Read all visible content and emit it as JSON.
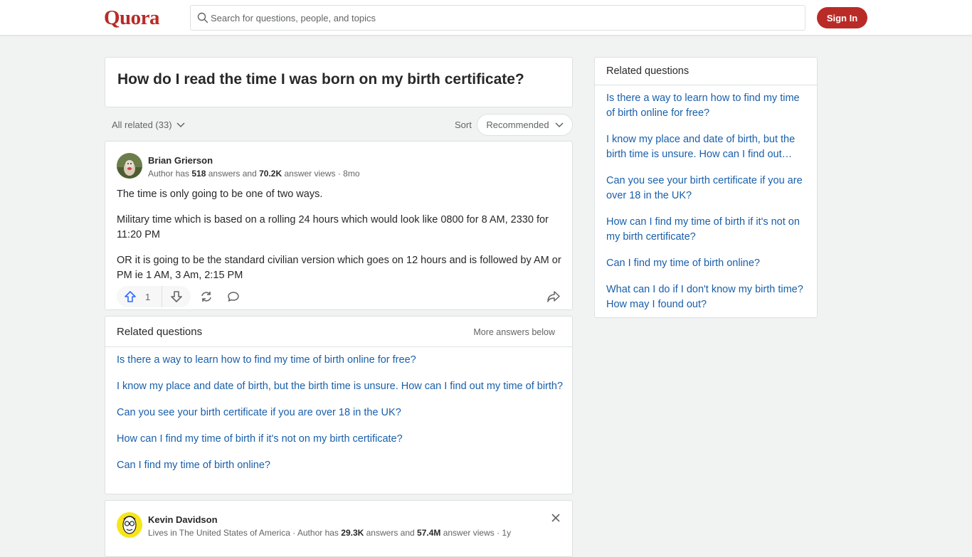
{
  "header": {
    "logo": "Quora",
    "search_placeholder": "Search for questions, people, and topics",
    "signin_label": "Sign In"
  },
  "question": {
    "title": "How do I read the time I was born on my birth certificate?"
  },
  "filters": {
    "all_related": "All related (33)",
    "sort_label": "Sort",
    "sort_value": "Recommended"
  },
  "answers": [
    {
      "author": "Brian Grierson",
      "meta_prefix": "Author has ",
      "answers_count": "518",
      "meta_mid": " answers and ",
      "views": "70.2K",
      "meta_suffix": " answer views · 8mo",
      "paragraphs": [
        "The time is only going to be one of two ways.",
        "Military time which is based on a rolling 24 hours which would look like 0800 for 8 AM, 2330 for 11:20 PM",
        "OR it is going to be the standard civilian version which goes on 12 hours and is followed by AM or PM ie 1 AM, 3 Am, 2:15 PM"
      ],
      "upvotes": "1"
    },
    {
      "author": "Kevin Davidson",
      "meta_prefix": "Lives in The United States of America · Author has ",
      "answers_count": "29.3K",
      "meta_mid": " answers and ",
      "views": "57.4M",
      "meta_suffix": " answer views · 1y"
    }
  ],
  "related_inline": {
    "heading": "Related questions",
    "more": "More answers below",
    "items": [
      "Is there a way to learn how to find my time of birth online for free?",
      "I know my place and date of birth, but the birth time is unsure. How can I find out my time of birth?",
      "Can you see your birth certificate if you are over 18 in the UK?",
      "How can I find my time of birth if it's not on my birth certificate?",
      "Can I find my time of birth online?"
    ]
  },
  "sidebar": {
    "heading": "Related questions",
    "items": [
      "Is there a way to learn how to find my time of birth online for free?",
      "I know my place and date of birth, but the birth time is unsure. How can I find out…",
      "Can you see your birth certificate if you are over 18 in the UK?",
      "How can I find my time of birth if it's not on my birth certificate?",
      "Can I find my time of birth online?",
      "What can I do if I don't know my birth time? How may I found out?"
    ]
  },
  "colors": {
    "brand": "#b92b27",
    "link": "#195faa",
    "upvote": "#2e69ff"
  }
}
